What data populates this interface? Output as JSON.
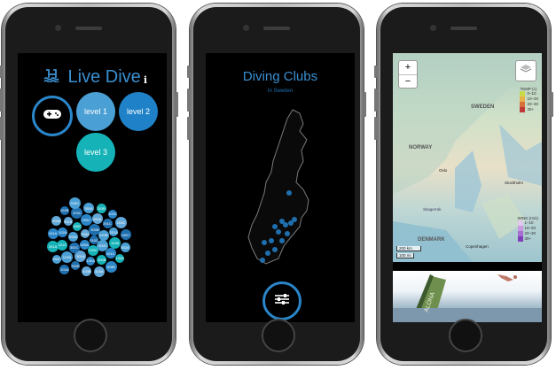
{
  "phone1": {
    "app_title": "Live Dive",
    "logo_icon": "swimmer-icon",
    "info_label": "i",
    "controller_icon": "gamepad-icon",
    "levels": [
      {
        "label": "level 1",
        "color": "#4a9fd4"
      },
      {
        "label": "level 2",
        "color": "#1f82c8"
      },
      {
        "label": "level 3",
        "color": "#15b3b8"
      }
    ],
    "bubbles": [
      "010C",
      "000C",
      "020C",
      "020A",
      "003A",
      "300B",
      "020B",
      "100B",
      "100A",
      "301A",
      "302C",
      "010A",
      "300C",
      "200C",
      "200A",
      "201C",
      "201A",
      "103A",
      "101C",
      "103B",
      "302B",
      "101B",
      "101C",
      "102A",
      "201B",
      "203C",
      "300A",
      "203B",
      "102C",
      "103C",
      "100C",
      "302A",
      "100A",
      "300B",
      "103A",
      "202A",
      "202C",
      "201A",
      "101A",
      "203A",
      "102B",
      "010C"
    ]
  },
  "phone2": {
    "title": "Diving Clubs",
    "subtitle": "In Sweden",
    "filter_icon": "sliders-icon"
  },
  "phone3": {
    "zoom_in": "+",
    "zoom_out": "−",
    "layers_icon": "layers-icon",
    "temp_title": "TEMP (c)",
    "temp_items": [
      {
        "label": "0–10",
        "color": "#c8d94a"
      },
      {
        "label": "10–20",
        "color": "#e8b24a"
      },
      {
        "label": "20–30",
        "color": "#d8703c"
      },
      {
        "label": "30+",
        "color": "#c03a3a"
      }
    ],
    "wind_title": "WIND (m/s)",
    "wind_items": [
      {
        "label": "1–10",
        "color": "#e0c8ef"
      },
      {
        "label": "10–20",
        "color": "#c89ae0"
      },
      {
        "label": "20–30",
        "color": "#a56ed0"
      },
      {
        "label": "30+",
        "color": "#7e3fb8"
      }
    ],
    "countries": [
      "NORWAY",
      "SWEDEN",
      "DENMARK"
    ],
    "cities": [
      "Oslo",
      "Stockholm",
      "Copenhagen",
      "Skagerrak"
    ],
    "scale_km": "200 km",
    "scale_mi": "100 mi",
    "photo_text": "ALONA"
  }
}
